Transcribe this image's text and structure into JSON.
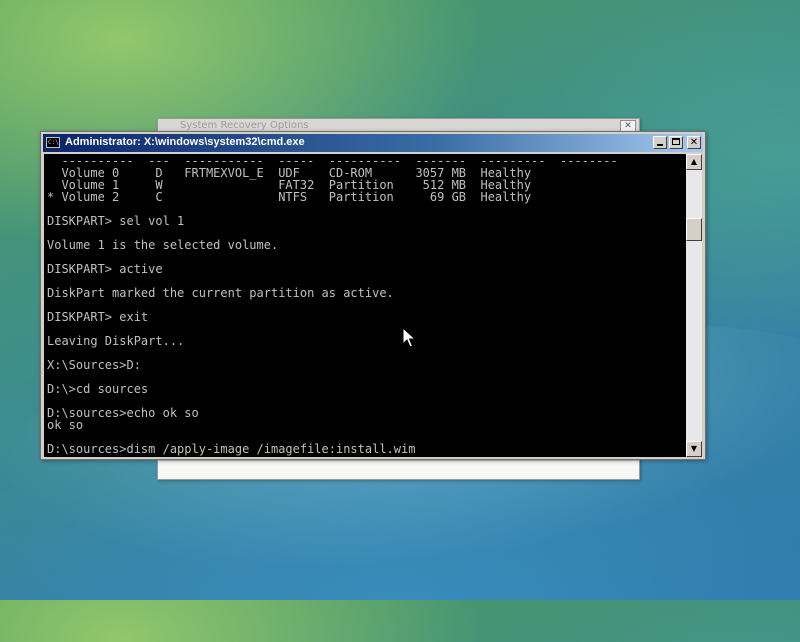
{
  "background_window": {
    "title": "System Recovery Options",
    "close_glyph": "✕"
  },
  "cmd_window": {
    "title": "Administrator: X:\\windows\\system32\\cmd.exe",
    "icon_text": "C:\\",
    "buttons": {
      "close_glyph": "✕"
    },
    "console_lines": [
      "  ----------  ---  -----------  -----  ----------  -------  ---------  --------",
      "  Volume 0     D   FRTMEXVOL_E  UDF    CD-ROM      3057 MB  Healthy",
      "  Volume 1     W                FAT32  Partition    512 MB  Healthy",
      "* Volume 2     C                NTFS   Partition     69 GB  Healthy",
      "",
      "DISKPART> sel vol 1",
      "",
      "Volume 1 is the selected volume.",
      "",
      "DISKPART> active",
      "",
      "DiskPart marked the current partition as active.",
      "",
      "DISKPART> exit",
      "",
      "Leaving DiskPart...",
      "",
      "X:\\Sources>D:",
      "",
      "D:\\>cd sources",
      "",
      "D:\\sources>echo ok so",
      "ok so",
      "",
      "D:\\sources>dism /apply-image /imagefile:install.wim"
    ],
    "scrollbar": {
      "up_glyph": "▲",
      "down_glyph": "▼"
    }
  },
  "colors": {
    "console_bg": "#000000",
    "console_text": "#c0c0c0",
    "titlebar_start": "#0a246a",
    "titlebar_end": "#a6caf0"
  },
  "icons": [
    "cmd-icon",
    "minimize-icon",
    "maximize-icon",
    "close-icon",
    "arrow-cursor-icon"
  ]
}
